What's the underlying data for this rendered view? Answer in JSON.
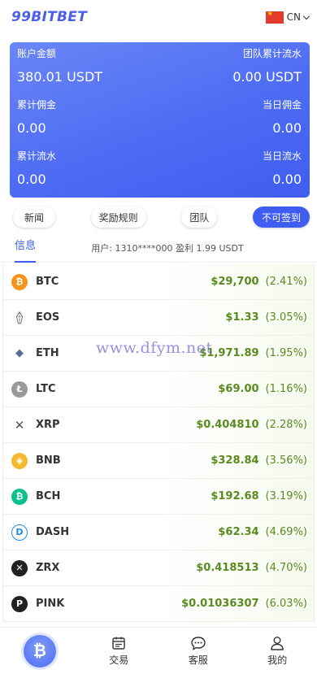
{
  "header": {
    "logo": "99BITBET",
    "lang": "CN"
  },
  "account": {
    "balance_label": "账户金额",
    "balance_value": "380.01 USDT",
    "team_flow_label": "团队累计流水",
    "team_flow_value": "0.00 USDT",
    "commission_label": "累计佣金",
    "commission_value": "0.00",
    "today_commission_label": "当日佣金",
    "today_commission_value": "0.00",
    "flow_label": "累计流水",
    "flow_value": "0.00",
    "today_flow_label": "当日流水",
    "today_flow_value": "0.00"
  },
  "actions": {
    "news": "新闻",
    "rules": "奖励规则",
    "team": "团队",
    "signin": "不可签到"
  },
  "tabs": {
    "info": "信息",
    "ticker": "用户: 1310****000 盈利 1.99 USDT"
  },
  "coins": [
    {
      "symbol": "BTC",
      "price": "$29,700",
      "change": "(2.41%)",
      "icon": "bitcoin-icon",
      "color": "#f7931a",
      "glyph": "₿"
    },
    {
      "symbol": "EOS",
      "price": "$1.33",
      "change": "(3.05%)",
      "icon": "eos-icon",
      "color": "#ffffff",
      "glyph": ""
    },
    {
      "symbol": "ETH",
      "price": "$1,971.89",
      "change": "(1.95%)",
      "icon": "ethereum-icon",
      "color": "#ffffff",
      "glyph": "◆"
    },
    {
      "symbol": "LTC",
      "price": "$69.00",
      "change": "(1.16%)",
      "icon": "litecoin-icon",
      "color": "#9a9a9a",
      "glyph": "Ł"
    },
    {
      "symbol": "XRP",
      "price": "$0.404810",
      "change": "(2.28%)",
      "icon": "xrp-icon",
      "color": "#ffffff",
      "glyph": "✕"
    },
    {
      "symbol": "BNB",
      "price": "$328.84",
      "change": "(3.56%)",
      "icon": "bnb-icon",
      "color": "#f3ba2f",
      "glyph": "◈"
    },
    {
      "symbol": "BCH",
      "price": "$192.68",
      "change": "(3.19%)",
      "icon": "bch-icon",
      "color": "#0ac18e",
      "glyph": "₿"
    },
    {
      "symbol": "DASH",
      "price": "$62.34",
      "change": "(4.69%)",
      "icon": "dash-icon",
      "color": "#ffffff",
      "glyph": "D"
    },
    {
      "symbol": "ZRX",
      "price": "$0.418513",
      "change": "(4.70%)",
      "icon": "zrx-icon",
      "color": "#222222",
      "glyph": "✕"
    },
    {
      "symbol": "PINK",
      "price": "$0.01036307",
      "change": "(6.03%)",
      "icon": "pink-icon",
      "color": "#222222",
      "glyph": "P"
    }
  ],
  "watermark": "www.dfym.net",
  "nav": {
    "home_glyph": "₿",
    "trade": "交易",
    "service": "客服",
    "mine": "我的"
  },
  "colors": {
    "accent": "#3f5df0",
    "positive": "#5a8a1f"
  }
}
